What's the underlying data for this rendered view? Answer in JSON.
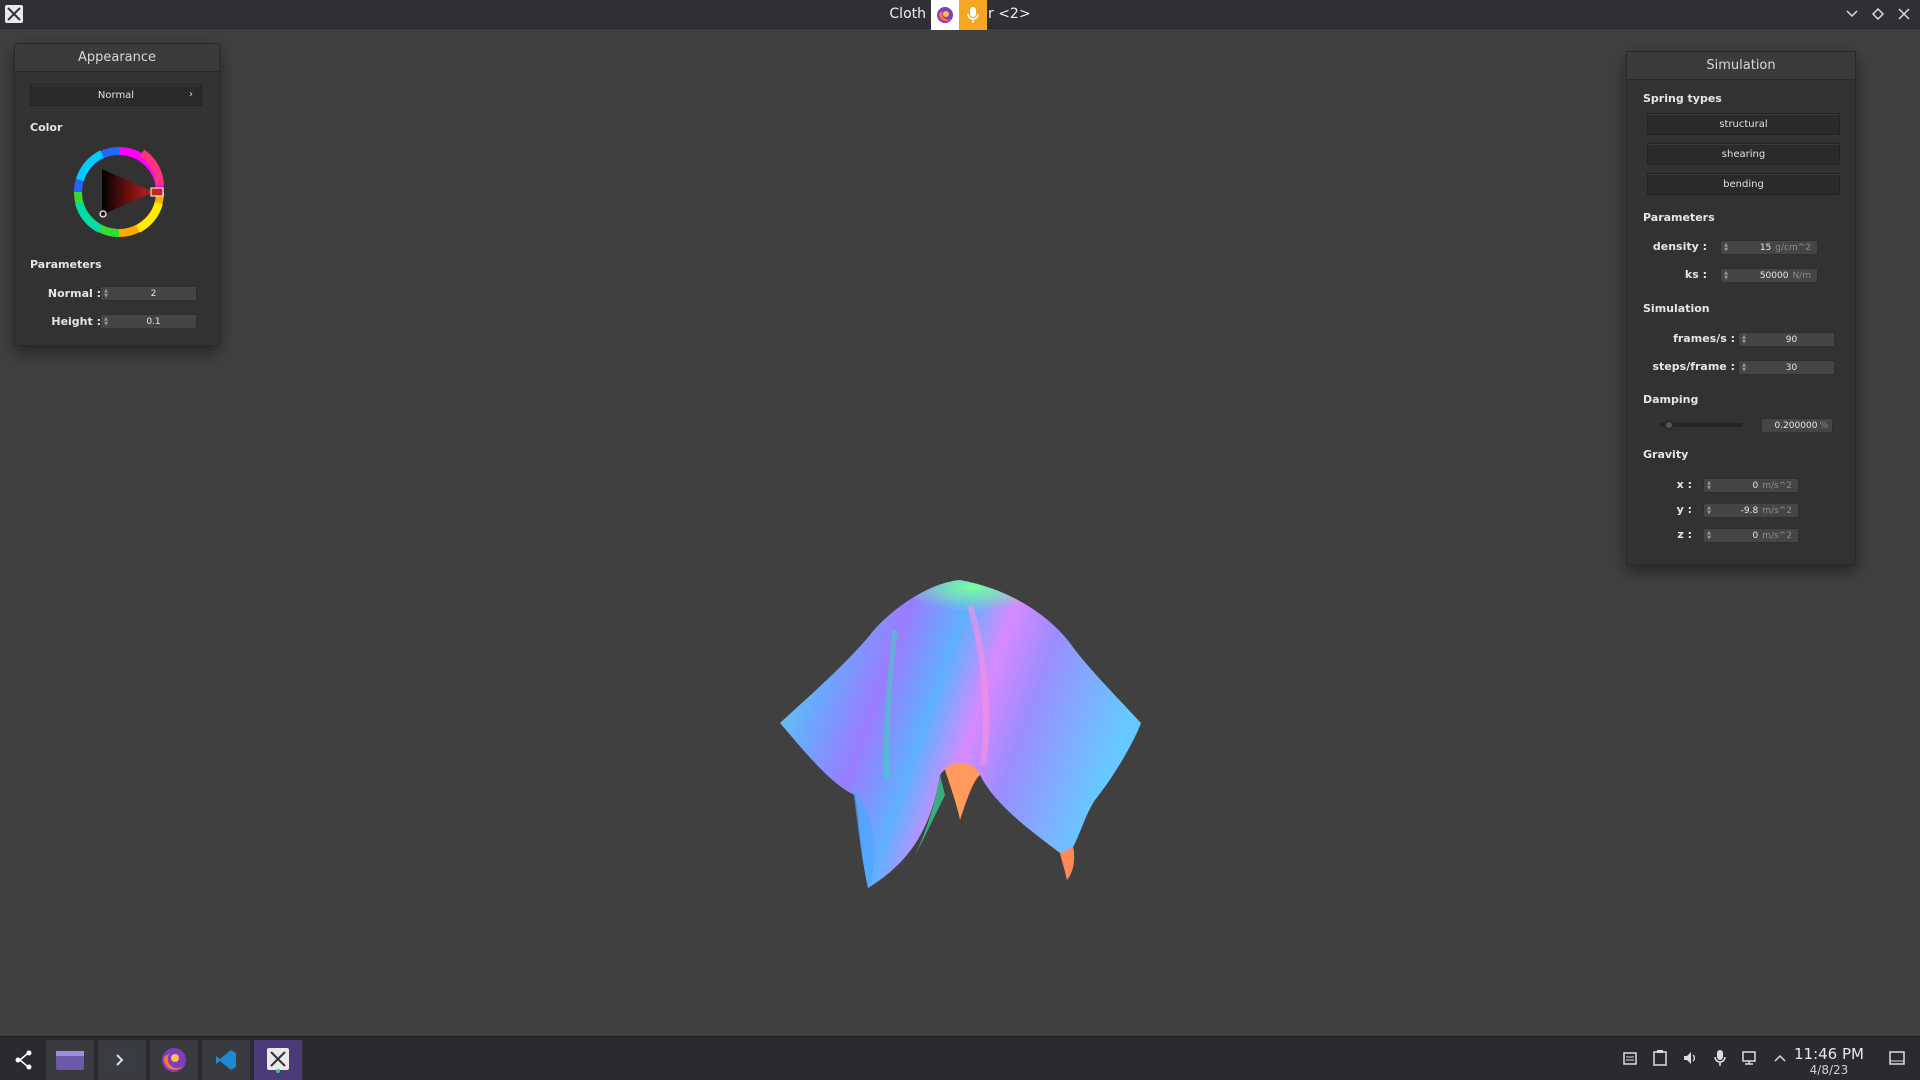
{
  "window": {
    "title_left": "Cloth",
    "title_right": "r <2>",
    "icons": [
      "app-x-icon",
      "firefox-icon",
      "microphone-icon",
      "chevron-down-icon",
      "diamond-icon",
      "close-icon"
    ]
  },
  "appearance": {
    "header": "Appearance",
    "mode": "Normal",
    "color_label": "Color",
    "params_label": "Parameters",
    "params": [
      {
        "label": "Normal :",
        "value": "2"
      },
      {
        "label": "Height :",
        "value": "0.1"
      }
    ],
    "color_wheel_selected": "#cc2222"
  },
  "simulation": {
    "header": "Simulation",
    "spring_label": "Spring types",
    "springs": [
      "structural",
      "shearing",
      "bending"
    ],
    "params_label": "Parameters",
    "params": [
      {
        "label": "density :",
        "value": "15",
        "unit": "g/cm^2"
      },
      {
        "label": "ks :",
        "value": "50000",
        "unit": "N/m"
      }
    ],
    "sim_label": "Simulation",
    "sim": [
      {
        "label": "frames/s :",
        "value": "90"
      },
      {
        "label": "steps/frame :",
        "value": "30"
      }
    ],
    "damping_label": "Damping",
    "damping": {
      "value": "0.200000",
      "unit": "%",
      "fraction": 0.2
    },
    "gravity_label": "Gravity",
    "gravity": [
      {
        "label": "x :",
        "value": "0",
        "unit": "m/s^2"
      },
      {
        "label": "y :",
        "value": "-9.8",
        "unit": "m/s^2"
      },
      {
        "label": "z :",
        "value": "0",
        "unit": "m/s^2"
      }
    ]
  },
  "taskbar": {
    "apps": [
      "launcher-icon",
      "file-manager-icon",
      "terminal-icon",
      "firefox-icon",
      "vscode-icon",
      "cloth-app-icon"
    ],
    "tray": [
      "clipboard-icon",
      "notes-icon",
      "volume-icon",
      "microphone-icon",
      "network-icon",
      "expand-tray-icon"
    ],
    "time": "11:46 PM",
    "date": "4/8/23"
  },
  "colors": {
    "background": "#404040",
    "panel": "#323232",
    "taskbar_active": "#4b3a78",
    "mic_overlay": "#f5a623"
  }
}
